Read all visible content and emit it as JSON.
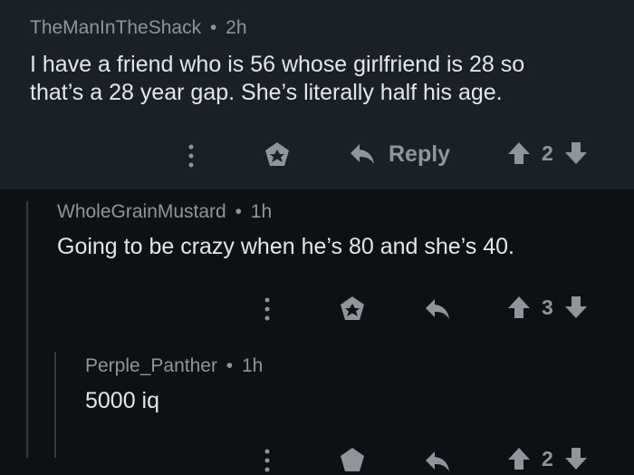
{
  "colors": {
    "comment_bg": "#1a2126",
    "page_bg": "#0e1113",
    "muted": "#8e969c",
    "text": "#e4e7e9"
  },
  "comments": [
    {
      "author": "TheManInTheShack",
      "separator": "•",
      "age": "2h",
      "lines": [
        "I have a friend who is 56 whose girlfriend is 28 so",
        "that’s a 28 year gap. She’s literally half his age."
      ],
      "actions": {
        "more_icon": "more-vertical-icon",
        "award_icon": "award-icon",
        "reply_icon": "reply-icon",
        "reply_label": "Reply",
        "upvote_icon": "upvote-icon",
        "score": "2",
        "downvote_icon": "downvote-icon"
      }
    },
    {
      "author": "WholeGrainMustard",
      "separator": "•",
      "age": "1h",
      "lines": [
        "Going to be crazy when he’s 80 and she’s 40."
      ],
      "actions": {
        "more_icon": "more-vertical-icon",
        "award_icon": "award-icon",
        "reply_icon": "reply-icon",
        "upvote_icon": "upvote-icon",
        "score": "3",
        "downvote_icon": "downvote-icon"
      }
    },
    {
      "author": "Perple_Panther",
      "separator": "•",
      "age": "1h",
      "lines": [
        "5000 iq"
      ],
      "actions": {
        "more_icon": "more-vertical-icon",
        "award_icon": "award-icon",
        "reply_icon": "reply-icon",
        "upvote_icon": "upvote-icon",
        "score": "2",
        "downvote_icon": "downvote-icon"
      }
    }
  ]
}
